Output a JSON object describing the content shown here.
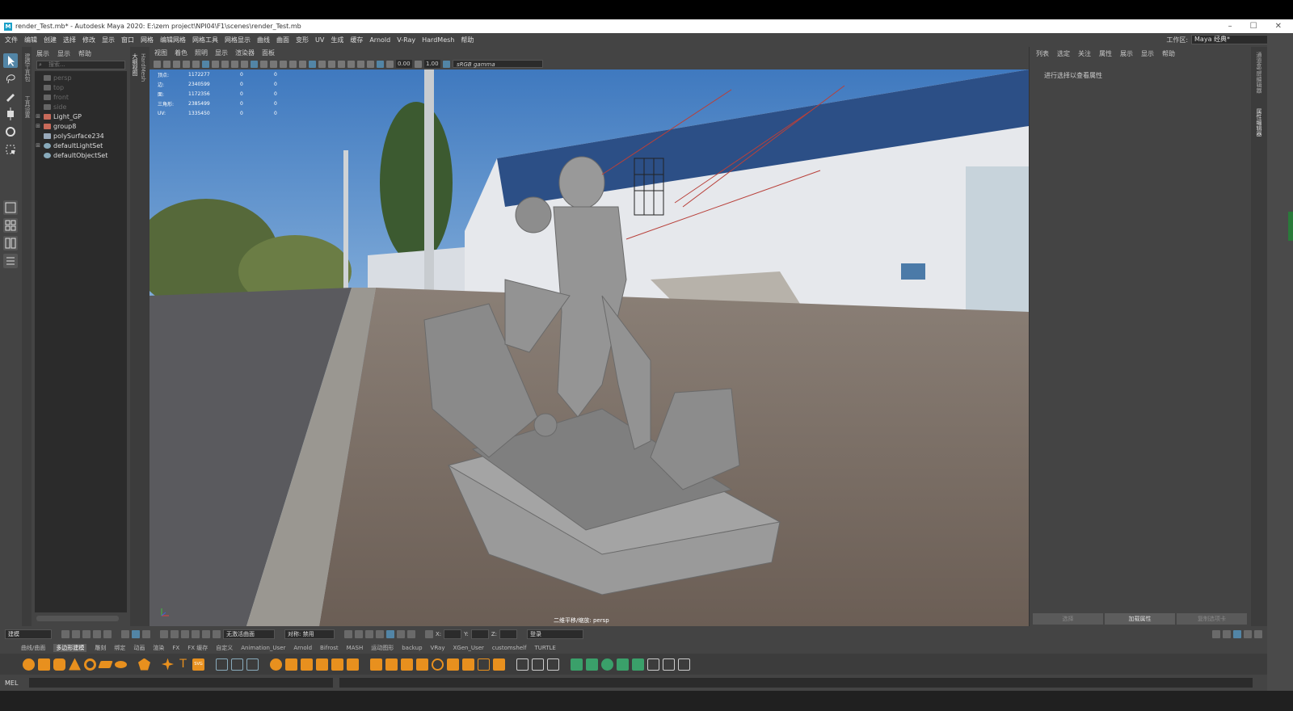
{
  "title": {
    "text": "render_Test.mb* - Autodesk Maya 2020: E:\\zem project\\NPI04\\F1\\scenes\\render_Test.mb",
    "logo": "M"
  },
  "window_controls": [
    "–",
    "☐",
    "✕"
  ],
  "menubar": [
    "文件",
    "编辑",
    "创建",
    "选择",
    "修改",
    "显示",
    "窗口",
    "网格",
    "编辑网格",
    "网格工具",
    "网格显示",
    "曲线",
    "曲面",
    "变形",
    "UV",
    "生成",
    "缓存",
    "Arnold",
    "V-Ray",
    "HardMesh",
    "帮助"
  ],
  "workspace": {
    "label": "工作区:",
    "value": "Maya 经典*"
  },
  "side_labels": {
    "modeling_toolkit": "建模工具包",
    "tool_settings": "工具设置",
    "outliner_tab": "大纲视图",
    "hardmesh_tab": "HardMesh",
    "attr_editor": "属性编辑器",
    "channel_box": "通道盒/层编辑器"
  },
  "outliner": {
    "menu": [
      "展示",
      "显示",
      "帮助"
    ],
    "search_placeholder": "搜索...",
    "items": [
      {
        "label": "persp",
        "dim": true,
        "expand": "",
        "icon": "camera-icon"
      },
      {
        "label": "top",
        "dim": true,
        "expand": "",
        "icon": "camera-icon"
      },
      {
        "label": "front",
        "dim": true,
        "expand": "",
        "icon": "camera-icon"
      },
      {
        "label": "side",
        "dim": true,
        "expand": "",
        "icon": "camera-icon"
      },
      {
        "label": "Light_GP",
        "dim": false,
        "expand": "⊞",
        "icon": "group-icon"
      },
      {
        "label": "group8",
        "dim": false,
        "expand": "⊞",
        "icon": "group-icon"
      },
      {
        "label": "polySurface234",
        "dim": false,
        "expand": "",
        "icon": "mesh-icon"
      },
      {
        "label": "defaultLightSet",
        "dim": false,
        "expand": "⊞",
        "icon": "set-icon"
      },
      {
        "label": "defaultObjectSet",
        "dim": false,
        "expand": "",
        "icon": "set-icon"
      }
    ]
  },
  "viewport": {
    "menu": [
      "视图",
      "着色",
      "照明",
      "显示",
      "渲染器",
      "面板"
    ],
    "exposure": "0.00",
    "gamma": "1.00",
    "color_space": "sRGB gamma",
    "hud": [
      {
        "k": "顶点:",
        "v": "1172277",
        "a": "0",
        "b": "0"
      },
      {
        "k": "边:",
        "v": "2340599",
        "a": "0",
        "b": "0"
      },
      {
        "k": "面:",
        "v": "1172356",
        "a": "0",
        "b": "0"
      },
      {
        "k": "三角形:",
        "v": "2385499",
        "a": "0",
        "b": "0"
      },
      {
        "k": "UV:",
        "v": "1335450",
        "a": "0",
        "b": "0"
      }
    ],
    "camera_label": "二维平移/缩放: persp"
  },
  "attribute_editor": {
    "menu": [
      "列表",
      "选定",
      "关注",
      "属性",
      "展示",
      "显示",
      "帮助"
    ],
    "hint": "进行选择以查看属性",
    "buttons": [
      "选择",
      "加载属性",
      "复制选项卡"
    ]
  },
  "status_line": {
    "mode": "建模",
    "no_live_surface": "无激活曲面",
    "symmetry": "对称: 禁用",
    "x_label": "X:",
    "y_label": "Y:",
    "z_label": "Z:",
    "login": "登录"
  },
  "shelf_tabs": [
    "曲线/曲面",
    "多边形建模",
    "雕刻",
    "绑定",
    "动画",
    "渲染",
    "FX",
    "FX 缓存",
    "自定义",
    "Animation_User",
    "Arnold",
    "Bifrost",
    "MASH",
    "运动图形",
    "backup",
    "VRay",
    "XGen_User",
    "customshelf",
    "TURTLE"
  ],
  "shelf_active": "多边形建模",
  "shelf_icon_text": {
    "text_tool": "T",
    "svg_tool": "SVG"
  },
  "command_line": {
    "label": "MEL"
  },
  "colors": {
    "accent": "#5285a6",
    "bg": "#444444",
    "shelf_orange": "#e8901e",
    "shelf_green": "#3aa06a"
  }
}
